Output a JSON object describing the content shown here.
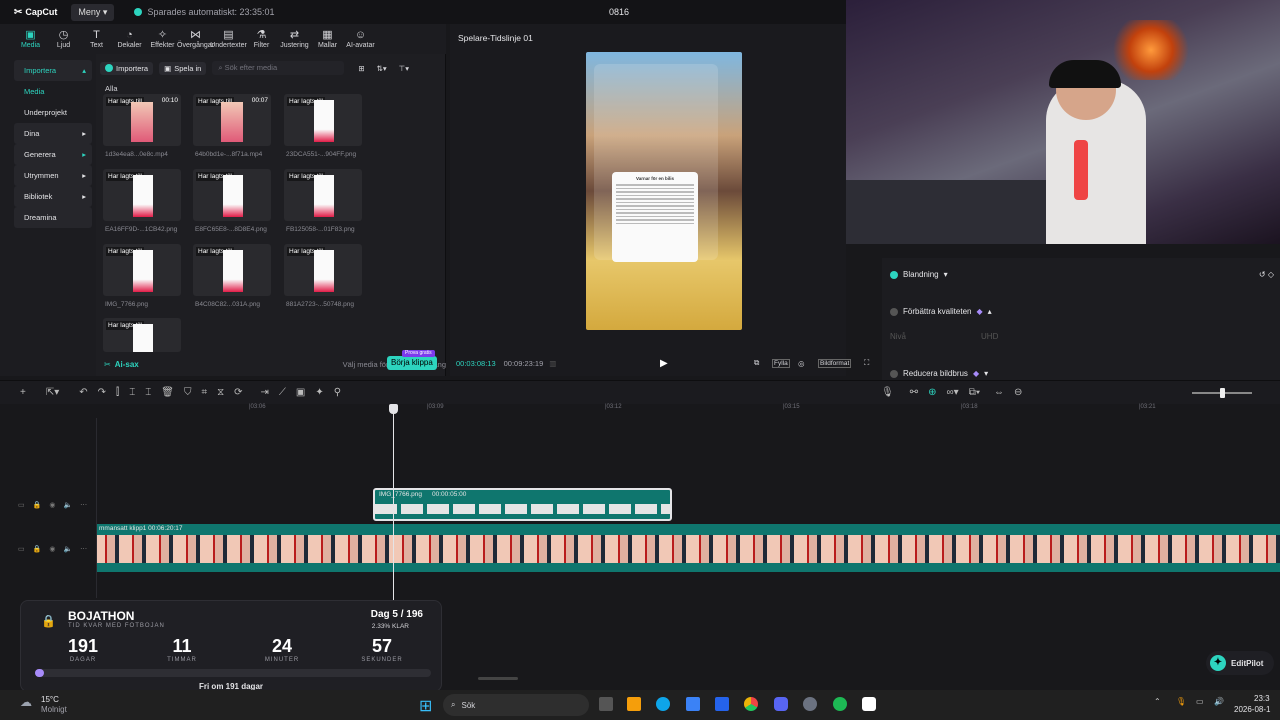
{
  "app": {
    "name": "CapCut",
    "menu_label": "Meny",
    "autosave": "Sparades automatiskt: 23:35:01",
    "project": "0816"
  },
  "toolbar": {
    "items": [
      {
        "label": "Media",
        "icon": "media-icon"
      },
      {
        "label": "Ljud",
        "icon": "audio-icon"
      },
      {
        "label": "Text",
        "icon": "text-icon"
      },
      {
        "label": "Dekaler",
        "icon": "sticker-icon"
      },
      {
        "label": "Effekter",
        "icon": "effects-icon"
      },
      {
        "label": "Övergångar",
        "icon": "transitions-icon"
      },
      {
        "label": "Undertexter",
        "icon": "captions-icon"
      },
      {
        "label": "Filter",
        "icon": "filter-icon"
      },
      {
        "label": "Justering",
        "icon": "adjust-icon"
      },
      {
        "label": "Mallar",
        "icon": "templates-icon"
      },
      {
        "label": "AI-avatar",
        "icon": "avatar-icon"
      }
    ]
  },
  "sidebar": {
    "items": [
      {
        "label": "Importera"
      },
      {
        "label": "Media"
      },
      {
        "label": "Underprojekt"
      },
      {
        "label": "Dina"
      },
      {
        "label": "Generera"
      },
      {
        "label": "Utrymmen"
      },
      {
        "label": "Bibliotek"
      },
      {
        "label": "Dreamina"
      }
    ]
  },
  "media": {
    "import_label": "Importera",
    "record_label": "Spela in",
    "search_placeholder": "Sök efter media",
    "section_label": "Alla",
    "added_tag": "Har lagts till",
    "items": [
      {
        "name": "1d3e4ea8...0e8c.mp4",
        "duration": "00:10",
        "kind": "video"
      },
      {
        "name": "64b0bd1e-...8f71a.mp4",
        "duration": "00:07",
        "kind": "video"
      },
      {
        "name": "23DCA551-...904FF.png",
        "duration": "",
        "kind": "doc"
      },
      {
        "name": "EA16FF9D-...1CB42.png",
        "duration": "",
        "kind": "doc"
      },
      {
        "name": "E8FC65E8-...8D8E4.png",
        "duration": "",
        "kind": "doc"
      },
      {
        "name": "FB125058-...01F83.png",
        "duration": "",
        "kind": "doc"
      },
      {
        "name": "IMG_7766.png",
        "duration": "",
        "kind": "doc"
      },
      {
        "name": "B4C08C82...031A.png",
        "duration": "",
        "kind": "doc"
      },
      {
        "name": "881A2723-...50748.png",
        "duration": "",
        "kind": "doc"
      },
      {
        "name": "",
        "duration": "",
        "kind": "doc"
      }
    ],
    "ai_label": "Ai-sax",
    "hint": "Välj media för att komma igång",
    "start_button": "Börja klippa",
    "start_badge": "Prova gratis"
  },
  "player": {
    "title": "Spelare-Tidslinje 01",
    "current_time": "00:03:08:13",
    "total_time": "00:09:23:19",
    "ratio_label": "Bildformat",
    "fit_label": "Fylla",
    "dialog_title": "Varnar för en bilis"
  },
  "properties": {
    "blend": "Blandning",
    "enhance": "Förbättra kvaliteten",
    "level_label": "Nivå",
    "level_value": "UHD",
    "denoise": "Reducera bildbrus"
  },
  "timeline": {
    "ruler": [
      "|03:06",
      "|03:09",
      "|03:12",
      "|03:15",
      "|03:18",
      "|03:21"
    ],
    "image_clip": {
      "name": "IMG_7766.png",
      "duration": "00:00:05:00"
    },
    "main_clip": {
      "name": "mmansatt klipp1",
      "duration": "00:06:20:17"
    }
  },
  "bojathon": {
    "title": "BOJATHON",
    "subtitle": "TID KVAR MED FOTBOJAN",
    "day": "Dag 5 / 196",
    "percent": "2.33% KLAR",
    "progress": 0.0233,
    "counts": [
      {
        "value": "191",
        "unit": "DAGAR"
      },
      {
        "value": "11",
        "unit": "TIMMAR"
      },
      {
        "value": "24",
        "unit": "MINUTER"
      },
      {
        "value": "57",
        "unit": "SEKUNDER"
      }
    ],
    "footer": "Fri om 191 dagar"
  },
  "editpilot": {
    "label": "EditPilot"
  },
  "taskbar": {
    "weather_temp": "15°C",
    "weather_text": "Molnigt",
    "search": "Sök",
    "time": "23:3",
    "date": "2026-08-1"
  },
  "colors": {
    "accent": "#2dd4bf",
    "clip": "#0f766e",
    "bg": "#18181b"
  }
}
